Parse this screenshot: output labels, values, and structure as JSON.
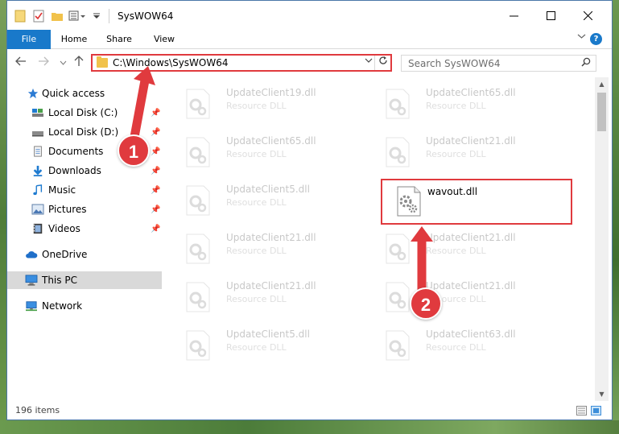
{
  "window": {
    "title": "SysWOW64"
  },
  "ribbon": {
    "tabs": [
      {
        "label": "File"
      },
      {
        "label": "Home"
      },
      {
        "label": "Share"
      },
      {
        "label": "View"
      }
    ],
    "help_label": "?"
  },
  "address": {
    "path": "C:\\Windows\\SysWOW64",
    "search_placeholder": "Search SysWOW64"
  },
  "navpane": {
    "items": [
      {
        "label": "Quick access",
        "icon": "star-icon"
      },
      {
        "label": "Local Disk (C:)",
        "icon": "drive-icon",
        "pinned": true
      },
      {
        "label": "Local Disk (D:)",
        "icon": "drive-icon",
        "pinned": true
      },
      {
        "label": "Documents",
        "icon": "documents-icon",
        "pinned": true
      },
      {
        "label": "Downloads",
        "icon": "downloads-icon",
        "pinned": true
      },
      {
        "label": "Music",
        "icon": "music-icon",
        "pinned": true
      },
      {
        "label": "Pictures",
        "icon": "pictures-icon",
        "pinned": true
      },
      {
        "label": "Videos",
        "icon": "videos-icon",
        "pinned": true
      },
      {
        "label": "OneDrive",
        "icon": "cloud-icon"
      },
      {
        "label": "This PC",
        "icon": "computer-icon",
        "selected": true
      },
      {
        "label": "Network",
        "icon": "network-icon"
      }
    ]
  },
  "files": {
    "left_column": [
      {
        "name": "UpdateClient19.dll",
        "type": "Resource DLL"
      },
      {
        "name": "UpdateClient65.dll",
        "type": "Resource DLL"
      },
      {
        "name": "UpdateClient5.dll",
        "type": "Resource DLL"
      },
      {
        "name": "UpdateClient21.dll",
        "type": "Resource DLL"
      },
      {
        "name": "UpdateClient21.dll",
        "type": "Resource DLL"
      },
      {
        "name": "UpdateClient5.dll",
        "type": "Resource DLL"
      }
    ],
    "right_column": [
      {
        "name": "UpdateClient65.dll",
        "type": "Resource DLL"
      },
      {
        "name": "UpdateClient21.dll",
        "type": "Resource DLL"
      },
      {
        "name": "wavout.dll",
        "type": "",
        "highlight": true
      },
      {
        "name": "UpdateClient21.dll",
        "type": "Resource DLL"
      },
      {
        "name": "UpdateClient21.dll",
        "type": "Resource DLL"
      },
      {
        "name": "UpdateClient63.dll",
        "type": "Resource DLL"
      }
    ]
  },
  "status": {
    "item_count": "196 items"
  },
  "annotations": {
    "step1": "1",
    "step2": "2",
    "color": "#e03a3e"
  }
}
